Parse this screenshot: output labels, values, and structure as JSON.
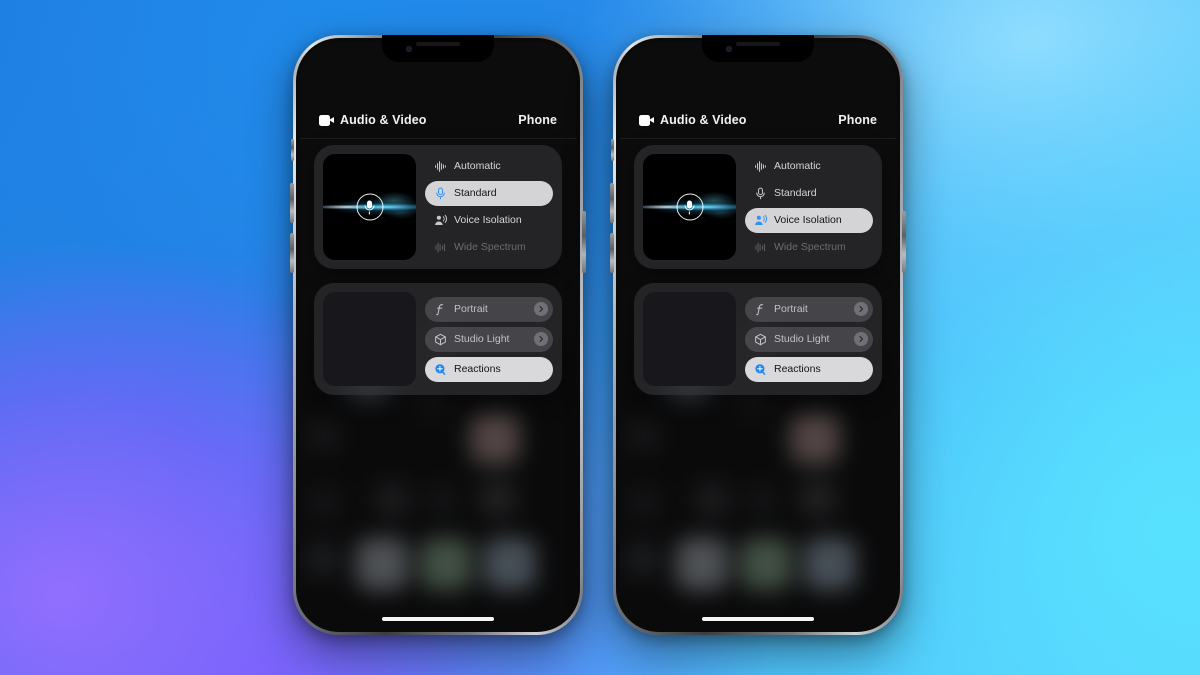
{
  "background": {
    "colors": [
      "#1f7fe0",
      "#2a86e6",
      "#49b6f7",
      "#5fe0fc",
      "#8a6bff",
      "#7d5ffa"
    ]
  },
  "accent": {
    "blue": "#2f92f5",
    "selected_pill": "#d4d4d6",
    "panel": "rgba(46,46,49,0.72)"
  },
  "phones": [
    {
      "id": "left",
      "header": {
        "title": "Audio & Video",
        "source": "Phone",
        "camera_icon": "video-camera-icon"
      },
      "mic_modes": {
        "preview_icon": "microphone-icon",
        "options": [
          {
            "label": "Automatic",
            "icon": "waveform-icon",
            "state": "normal"
          },
          {
            "label": "Standard",
            "icon": "microphone-icon",
            "state": "selected"
          },
          {
            "label": "Voice Isolation",
            "icon": "person-waves-icon",
            "state": "normal"
          },
          {
            "label": "Wide Spectrum",
            "icon": "wide-waveform-icon",
            "state": "disabled"
          }
        ]
      },
      "video_effects": {
        "options": [
          {
            "label": "Portrait",
            "icon": "f-stop-icon",
            "state": "chip",
            "chevron": true
          },
          {
            "label": "Studio Light",
            "icon": "cube-icon",
            "state": "chip",
            "chevron": true
          },
          {
            "label": "Reactions",
            "icon": "reactions-icon",
            "state": "selected",
            "chevron": false
          }
        ]
      }
    },
    {
      "id": "right",
      "header": {
        "title": "Audio & Video",
        "source": "Phone",
        "camera_icon": "video-camera-icon"
      },
      "mic_modes": {
        "preview_icon": "microphone-icon",
        "options": [
          {
            "label": "Automatic",
            "icon": "waveform-icon",
            "state": "normal"
          },
          {
            "label": "Standard",
            "icon": "microphone-icon",
            "state": "normal"
          },
          {
            "label": "Voice Isolation",
            "icon": "person-waves-icon",
            "state": "selected"
          },
          {
            "label": "Wide Spectrum",
            "icon": "wide-waveform-icon",
            "state": "disabled"
          }
        ]
      },
      "video_effects": {
        "options": [
          {
            "label": "Portrait",
            "icon": "f-stop-icon",
            "state": "chip",
            "chevron": true
          },
          {
            "label": "Studio Light",
            "icon": "cube-icon",
            "state": "chip",
            "chevron": true
          },
          {
            "label": "Reactions",
            "icon": "reactions-icon",
            "state": "selected",
            "chevron": false
          }
        ]
      }
    }
  ]
}
